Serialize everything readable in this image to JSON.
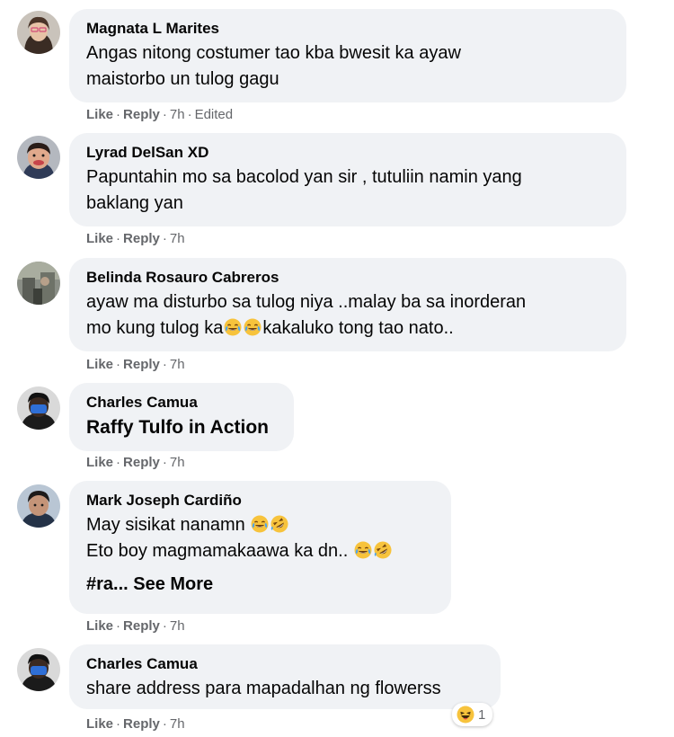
{
  "comments": [
    {
      "author": "Magnata L Marites",
      "lines": [
        "Angas nitong costumer tao kba bwesit ka ayaw",
        "maistorbo un tulog gagu"
      ],
      "like": "Like",
      "reply": "Reply",
      "time": "7h",
      "edited": "Edited"
    },
    {
      "author": "Lyrad DelSan XD",
      "lines": [
        "Papuntahin mo sa bacolod yan sir , tutuliin namin yang",
        "baklang yan"
      ],
      "like": "Like",
      "reply": "Reply",
      "time": "7h"
    },
    {
      "author": "Belinda Rosauro Cabreros",
      "line1": "ayaw ma disturbo sa tulog niya ..malay ba sa inorderan",
      "line2_a": "mo kung tulog ka",
      "line2_b": "kakaluko tong tao nato..",
      "like": "Like",
      "reply": "Reply",
      "time": "7h"
    },
    {
      "author": "Charles Camua",
      "line1": "Raffy Tulfo in Action",
      "like": "Like",
      "reply": "Reply",
      "time": "7h"
    },
    {
      "author": "Mark Joseph Cardiño",
      "line1": "May sisikat nanamn",
      "line2": "Eto boy magmamakaawa ka dn..",
      "truncated": "#ra... See More",
      "like": "Like",
      "reply": "Reply",
      "time": "7h"
    },
    {
      "author": "Charles Camua",
      "line1": "share address para mapadalhan ng flowerss",
      "like": "Like",
      "reply": "Reply",
      "time": "7h",
      "reaction_count": "1"
    }
  ],
  "colors": {
    "bubble": "#f0f2f5",
    "meta": "#65676b",
    "text": "#050505"
  },
  "icons": {
    "laughing": "tears-of-joy-emoji",
    "rolling": "rolling-on-floor-laughing-emoji",
    "haha_reaction": "haha-reaction-emoji"
  }
}
